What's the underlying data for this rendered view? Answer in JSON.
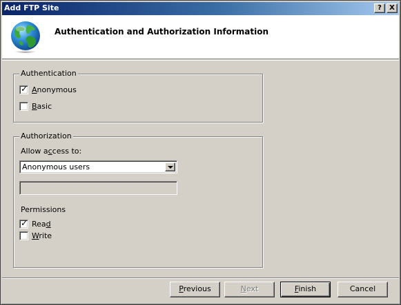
{
  "window": {
    "title": "Add FTP Site"
  },
  "titlebar_buttons": {
    "help": "?",
    "close": "X"
  },
  "header": {
    "title": "Authentication and Authorization Information",
    "icon": "globe-icon"
  },
  "authentication": {
    "legend": "Authentication",
    "anonymous": {
      "label_accel": "A",
      "label_rest": "nonymous",
      "checked": true
    },
    "basic": {
      "label_accel": "B",
      "label_rest": "asic",
      "checked": false
    }
  },
  "authorization": {
    "legend": "Authorization",
    "allow_access_label_pre": "Allow a",
    "allow_access_label_accel": "c",
    "allow_access_label_post": "cess to:",
    "allow_access_value": "Anonymous users",
    "users_textbox_value": "",
    "permissions_label": "Permissions",
    "read": {
      "label_pre": "Rea",
      "label_accel": "d",
      "checked": true
    },
    "write": {
      "label_accel": "W",
      "label_rest": "rite",
      "checked": false
    }
  },
  "footer": {
    "previous": {
      "accel": "P",
      "rest": "revious"
    },
    "next": {
      "accel": "N",
      "rest": "ext",
      "enabled": false
    },
    "finish": {
      "accel": "F",
      "rest": "inish"
    },
    "cancel": "Cancel"
  },
  "colors": {
    "dialog_bg": "#d4d0c8",
    "title_start": "#0a246a",
    "title_end": "#a6caf0"
  }
}
